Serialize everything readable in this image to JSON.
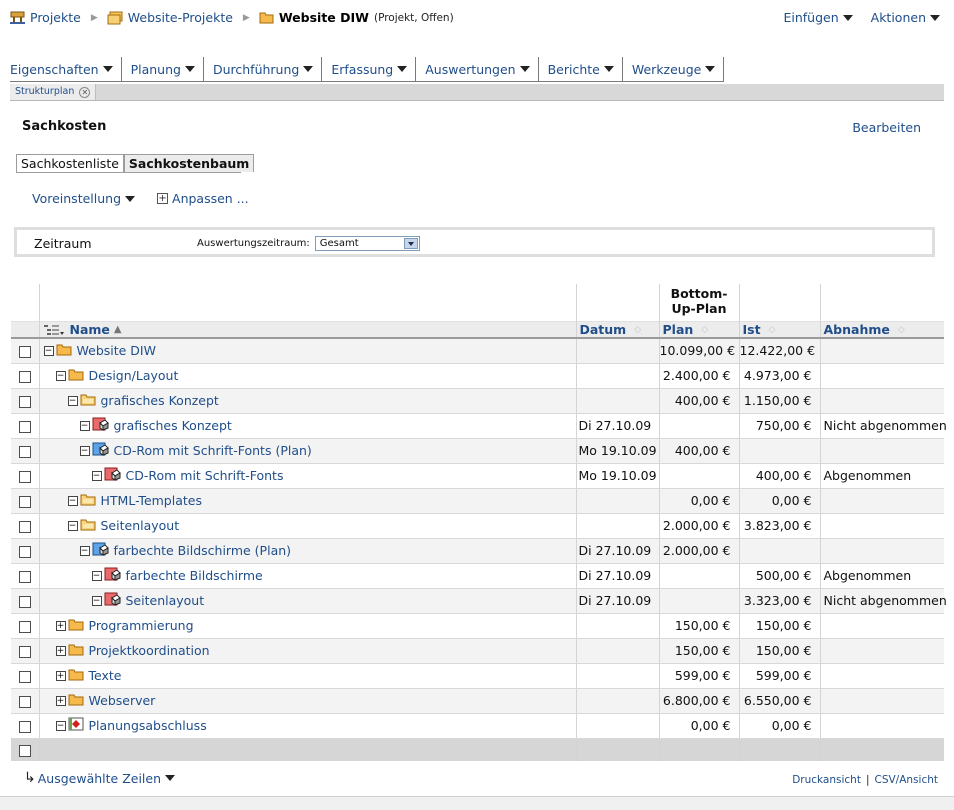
{
  "breadcrumb": {
    "items": [
      {
        "label": "Projekte",
        "icon": "projects-icon"
      },
      {
        "label": "Website-Projekte",
        "icon": "folder-stack-icon"
      }
    ],
    "current": {
      "label": "Website DIW",
      "status": "(Projekt, Offen)",
      "icon": "folder-icon"
    }
  },
  "top_actions": {
    "insert": "Einfügen",
    "actions": "Aktionen"
  },
  "menu": [
    "Eigenschaften",
    "Planung",
    "Durchführung",
    "Erfassung",
    "Auswertungen",
    "Berichte",
    "Werkzeuge"
  ],
  "tab": {
    "label": "Strukturplan"
  },
  "page": {
    "title": "Sachkosten",
    "edit_label": "Bearbeiten"
  },
  "subtabs": [
    "Sachkostenliste",
    "Sachkostenbaum"
  ],
  "toolbar": {
    "preset": "Voreinstellung",
    "adjust": "Anpassen ..."
  },
  "filter": {
    "label": "Zeitraum",
    "field_label": "Auswertungszeitraum:",
    "field_value": "Gesamt"
  },
  "columns": {
    "name": "Name",
    "date": "Datum",
    "plan_top": "Bottom-Up-Plan",
    "plan": "Plan",
    "actual": "Ist",
    "acceptance": "Abnahme"
  },
  "rows": [
    {
      "name": "Website DIW",
      "level": 0,
      "toggle": "−",
      "icon": "folder-icon",
      "date": "",
      "plan": "10.099,00 €",
      "actual": "12.422,00 €",
      "status": ""
    },
    {
      "name": "Design/Layout",
      "level": 1,
      "toggle": "−",
      "icon": "folder-icon",
      "date": "",
      "plan": "2.400,00 €",
      "actual": "4.973,00 €",
      "status": ""
    },
    {
      "name": "grafisches Konzept",
      "level": 2,
      "toggle": "−",
      "icon": "folder-open-icon",
      "date": "",
      "plan": "400,00 €",
      "actual": "1.150,00 €",
      "status": ""
    },
    {
      "name": "grafisches Konzept",
      "level": 3,
      "toggle": "−",
      "icon": "cost-item-icon",
      "date": "Di 27.10.09",
      "plan": "",
      "actual": "750,00 €",
      "status": "Nicht abgenommen"
    },
    {
      "name": "CD-Rom mit Schrift-Fonts (Plan)",
      "level": 3,
      "toggle": "−",
      "icon": "cost-plan-icon",
      "date": "Mo 19.10.09",
      "plan": "400,00 €",
      "actual": "",
      "status": ""
    },
    {
      "name": "CD-Rom mit Schrift-Fonts",
      "level": 4,
      "toggle": "−",
      "icon": "cost-item-icon",
      "date": "Mo 19.10.09",
      "plan": "",
      "actual": "400,00 €",
      "status": "Abgenommen"
    },
    {
      "name": "HTML-Templates",
      "level": 2,
      "toggle": "−",
      "icon": "folder-open-icon",
      "date": "",
      "plan": "0,00 €",
      "actual": "0,00 €",
      "status": ""
    },
    {
      "name": "Seitenlayout",
      "level": 2,
      "toggle": "−",
      "icon": "folder-open-icon",
      "date": "",
      "plan": "2.000,00 €",
      "actual": "3.823,00 €",
      "status": ""
    },
    {
      "name": "farbechte Bildschirme (Plan)",
      "level": 3,
      "toggle": "−",
      "icon": "cost-plan-icon",
      "date": "Di 27.10.09",
      "plan": "2.000,00 €",
      "actual": "",
      "status": ""
    },
    {
      "name": "farbechte Bildschirme",
      "level": 4,
      "toggle": "−",
      "icon": "cost-item-icon",
      "date": "Di 27.10.09",
      "plan": "",
      "actual": "500,00 €",
      "status": "Abgenommen"
    },
    {
      "name": "Seitenlayout",
      "level": 4,
      "toggle": "−",
      "icon": "cost-item-icon",
      "date": "Di 27.10.09",
      "plan": "",
      "actual": "3.323,00 €",
      "status": "Nicht abgenommen"
    },
    {
      "name": "Programmierung",
      "level": 1,
      "toggle": "+",
      "icon": "folder-icon",
      "date": "",
      "plan": "150,00 €",
      "actual": "150,00 €",
      "status": ""
    },
    {
      "name": "Projektkoordination",
      "level": 1,
      "toggle": "+",
      "icon": "folder-icon",
      "date": "",
      "plan": "150,00 €",
      "actual": "150,00 €",
      "status": ""
    },
    {
      "name": "Texte",
      "level": 1,
      "toggle": "+",
      "icon": "folder-icon",
      "date": "",
      "plan": "599,00 €",
      "actual": "599,00 €",
      "status": ""
    },
    {
      "name": "Webserver",
      "level": 1,
      "toggle": "+",
      "icon": "folder-icon",
      "date": "",
      "plan": "6.800,00 €",
      "actual": "6.550,00 €",
      "status": ""
    },
    {
      "name": "Planungsabschluss",
      "level": 1,
      "toggle": "−",
      "icon": "milestone-icon",
      "date": "",
      "plan": "0,00 €",
      "actual": "0,00 €",
      "status": ""
    }
  ],
  "bottom": {
    "selected_rows": "Ausgewählte Zeilen",
    "print": "Druckansicht",
    "csv": "CSV/Ansicht"
  }
}
